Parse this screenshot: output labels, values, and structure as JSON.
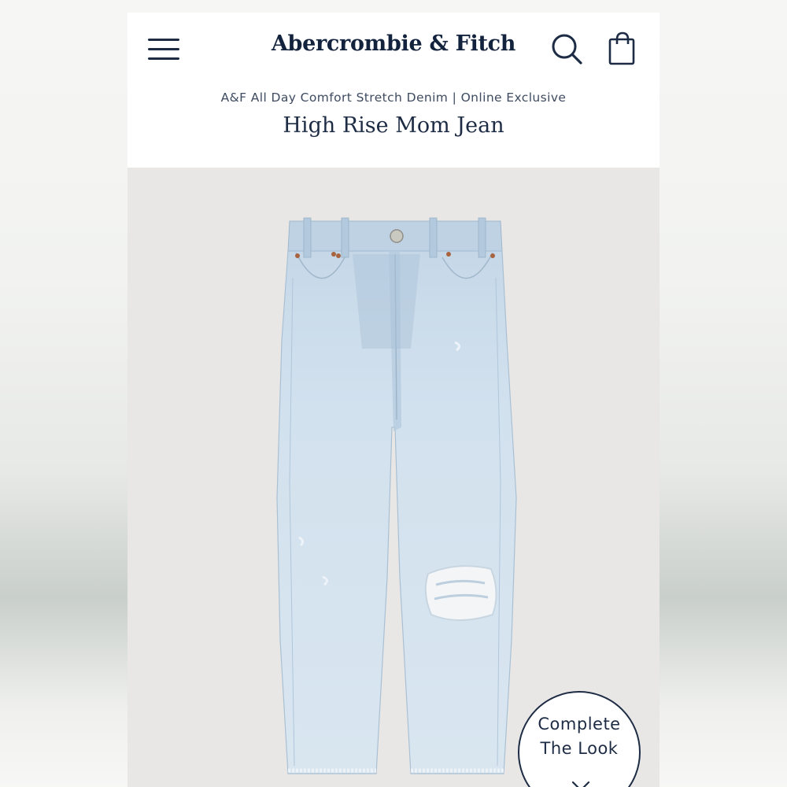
{
  "header": {
    "brand": "Abercrombie & Fitch",
    "menu_icon": "hamburger-menu-icon",
    "search_icon": "search-icon",
    "bag_icon": "shopping-bag-icon"
  },
  "product": {
    "subtitle": "A&F All Day Comfort Stretch Denim | Online Exclusive",
    "title": "High Rise Mom Jean",
    "image_subject": "light-wash ripped mom jeans"
  },
  "complete_look": {
    "line1": "Complete",
    "line2": "The Look",
    "icon": "chevron-down-icon"
  },
  "colors": {
    "navy": "#1d2c44",
    "denim_light": "#cfdfec",
    "image_background": "#e9e7e5"
  }
}
